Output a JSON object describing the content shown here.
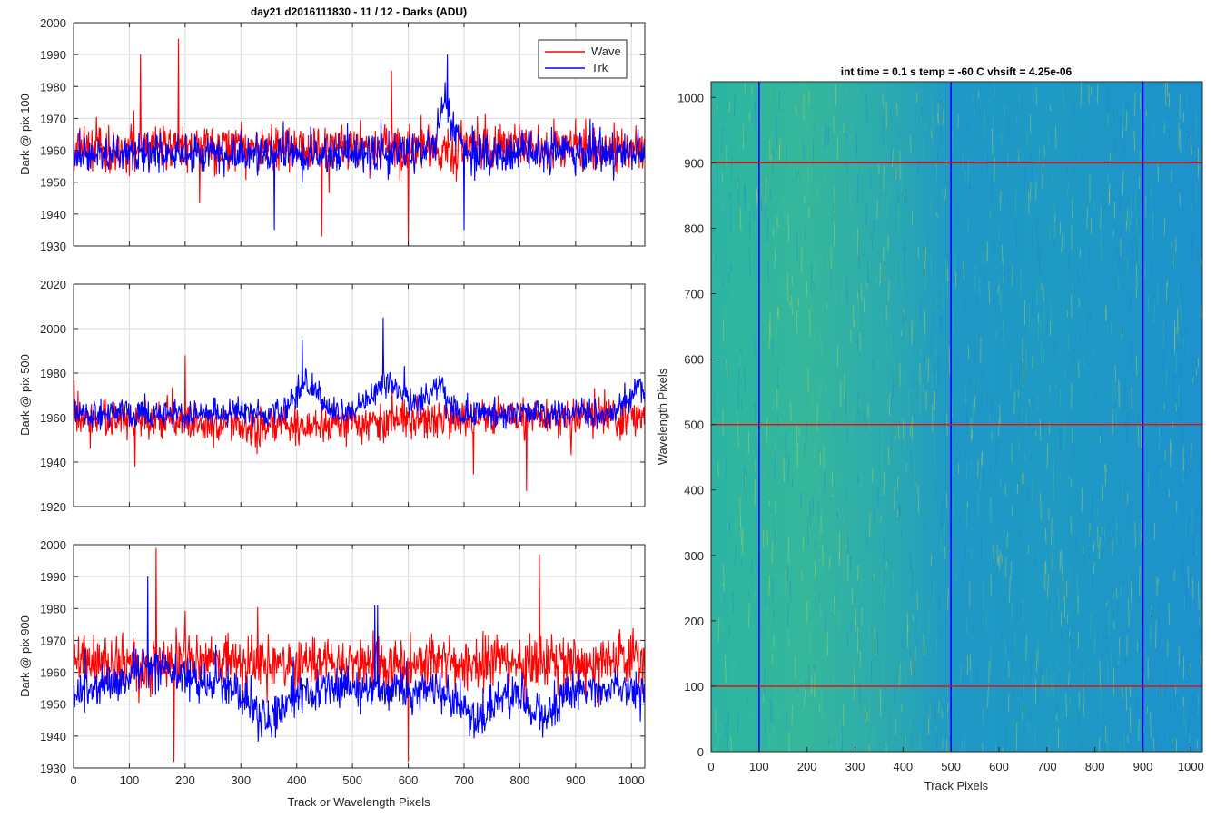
{
  "chart_data": [
    {
      "type": "line",
      "title": "day21 d2016111830 - 11 / 12 - Darks (ADU)",
      "xlabel": "",
      "ylabel": "Dark @ pix 100",
      "xlim": [
        0,
        1024
      ],
      "ylim": [
        1930,
        2000
      ],
      "xticks": [
        0,
        100,
        200,
        300,
        400,
        500,
        600,
        700,
        800,
        900,
        1000
      ],
      "yticks": [
        1930,
        1940,
        1950,
        1960,
        1970,
        1980,
        1990,
        2000
      ],
      "show_xtick_labels": false,
      "grid": true,
      "legend": "top-right",
      "series": [
        {
          "name": "Wave",
          "color": "#ff0000",
          "mean": 1961,
          "noise": 7,
          "spikes": [
            [
              188,
              1995
            ],
            [
              120,
              1990
            ],
            [
              570,
              1985
            ],
            [
              600,
              1930
            ],
            [
              445,
              1933
            ]
          ],
          "features": []
        },
        {
          "name": "Trk",
          "color": "#0000ff",
          "mean": 1959,
          "noise": 6,
          "spikes": [
            [
              670,
              1990
            ],
            [
              700,
              1935
            ],
            [
              360,
              1935
            ]
          ],
          "features": [
            [
              670,
              20,
              18
            ]
          ]
        }
      ]
    },
    {
      "type": "line",
      "title": "",
      "xlabel": "",
      "ylabel": "Dark @ pix 500",
      "xlim": [
        0,
        1024
      ],
      "ylim": [
        1920,
        2020
      ],
      "xticks": [
        0,
        100,
        200,
        300,
        400,
        500,
        600,
        700,
        800,
        900,
        1000
      ],
      "yticks": [
        1920,
        1940,
        1960,
        1980,
        2000,
        2020
      ],
      "show_xtick_labels": false,
      "grid": true,
      "legend": "",
      "series": [
        {
          "name": "Wave",
          "color": "#ff0000",
          "mean": 1961,
          "noise": 8,
          "spikes": [
            [
              110,
              1938
            ],
            [
              812,
              1927
            ],
            [
              200,
              1988
            ]
          ],
          "features": [
            [
              380,
              260,
              -6
            ]
          ]
        },
        {
          "name": "Trk",
          "color": "#0000ff",
          "mean": 1962,
          "noise": 6,
          "spikes": [
            [
              555,
              2005
            ],
            [
              410,
              1995
            ]
          ],
          "features": [
            [
              420,
              30,
              16
            ],
            [
              560,
              40,
              18
            ],
            [
              650,
              25,
              14
            ],
            [
              1010,
              20,
              14
            ]
          ]
        }
      ]
    },
    {
      "type": "line",
      "title": "",
      "xlabel": "Track or Wavelength Pixels",
      "ylabel": "Dark @ pix 900",
      "xlim": [
        0,
        1024
      ],
      "ylim": [
        1930,
        2000
      ],
      "xticks": [
        0,
        100,
        200,
        300,
        400,
        500,
        600,
        700,
        800,
        900,
        1000
      ],
      "yticks": [
        1930,
        1940,
        1950,
        1960,
        1970,
        1980,
        1990,
        2000
      ],
      "show_xtick_labels": true,
      "grid": true,
      "legend": "",
      "series": [
        {
          "name": "Wave",
          "color": "#ff0000",
          "mean": 1963,
          "noise": 8,
          "spikes": [
            [
              148,
              1999
            ],
            [
              835,
              1997
            ],
            [
              600,
              1932
            ],
            [
              180,
              1932
            ]
          ],
          "features": []
        },
        {
          "name": "Trk",
          "color": "#0000ff",
          "mean": 1955,
          "noise": 6,
          "spikes": [
            [
              540,
              1981
            ],
            [
              545,
              1981
            ],
            [
              133,
              1990
            ]
          ],
          "features": [
            [
              150,
              70,
              8
            ],
            [
              350,
              40,
              -12
            ],
            [
              720,
              40,
              -12
            ],
            [
              840,
              30,
              -12
            ]
          ]
        }
      ]
    },
    {
      "type": "heatmap",
      "title": "int time = 0.1 s   temp = -60 C   vhsift = 4.25e-06",
      "xlabel": "Track Pixels",
      "ylabel": "Wavelength Pixels",
      "xlim": [
        0,
        1024
      ],
      "ylim": [
        0,
        1024
      ],
      "xticks": [
        0,
        100,
        200,
        300,
        400,
        500,
        600,
        700,
        800,
        900,
        1000
      ],
      "yticks": [
        0,
        100,
        200,
        300,
        400,
        500,
        600,
        700,
        800,
        900,
        1000
      ],
      "colormap": "parula",
      "vlines": [
        100,
        500,
        900
      ],
      "vline_color": "#0000ff",
      "hlines": [
        100,
        500,
        900
      ],
      "hline_color": "#ff0000"
    }
  ]
}
